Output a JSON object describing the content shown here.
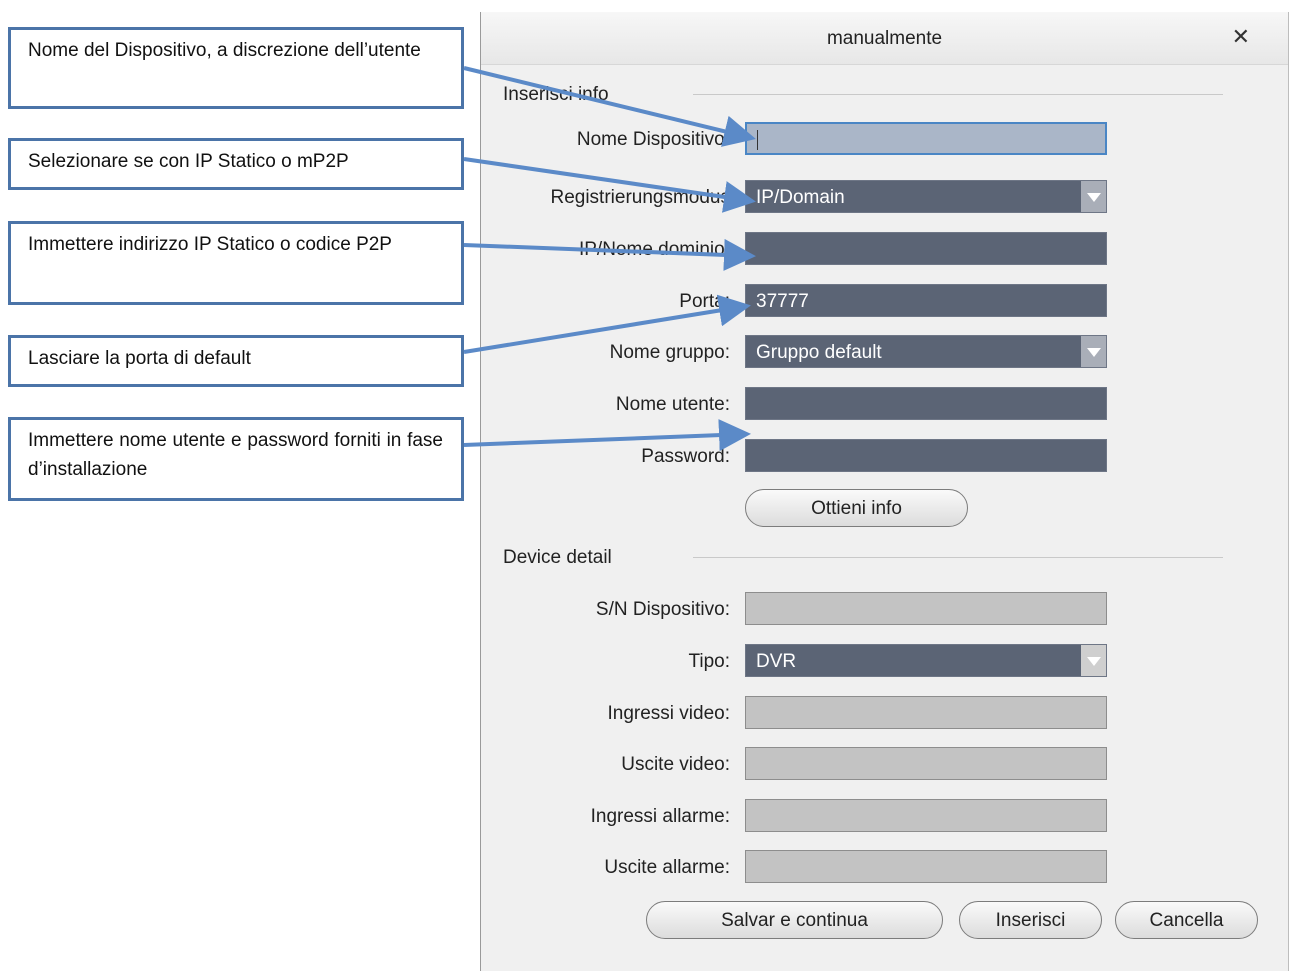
{
  "dialog": {
    "title": "manualmente",
    "close_glyph": "✕",
    "section_info": "Inserisci info",
    "section_detail": "Device detail"
  },
  "form": {
    "device_name_label": "Nome Dispositivo:",
    "device_name_value": "",
    "reg_mode_label": "Registrierungsmodus",
    "reg_mode_value": "IP/Domain",
    "ip_label": "IP/Nome dominio:",
    "ip_value": "",
    "port_label": "Porta:",
    "port_value": "37777",
    "group_label": "Nome gruppo:",
    "group_value": "Gruppo default",
    "user_label": "Nome utente:",
    "user_value": "",
    "password_label": "Password:",
    "password_value": "",
    "get_info_button": "Ottieni info"
  },
  "detail": {
    "sn_label": "S/N Dispositivo:",
    "sn_value": "",
    "type_label": "Tipo:",
    "type_value": "DVR",
    "video_in_label": "Ingressi video:",
    "video_in_value": "",
    "video_out_label": "Uscite video:",
    "video_out_value": "",
    "alarm_in_label": "Ingressi allarme:",
    "alarm_in_value": "",
    "alarm_out_label": "Uscite allarme:",
    "alarm_out_value": ""
  },
  "buttons": {
    "save_continue": "Salvar e continua",
    "add": "Inserisci",
    "cancel": "Cancella"
  },
  "annotations": {
    "name": "Nome del Dispositivo, a discrezione dell’utente",
    "mode": "Selezionare se con IP Statico o mP2P",
    "ip": "Immettere indirizzo IP Statico o codice P2P",
    "port": "Lasciare la porta di default",
    "credentials": "Immettere nome utente e password forniti in fase d’installazione"
  },
  "colors": {
    "annotation_border": "#4b74a8",
    "arrow": "#5b8ac8",
    "dark_field": "#5b6475",
    "gray_field": "#c3c3c3"
  }
}
